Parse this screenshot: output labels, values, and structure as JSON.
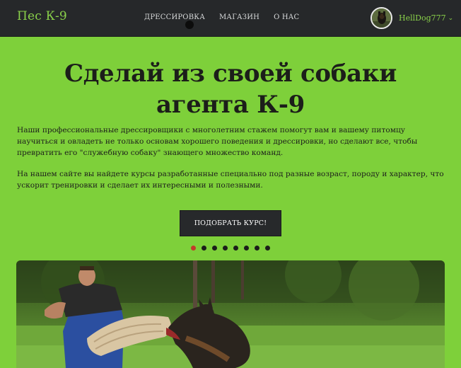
{
  "navbar": {
    "brand": "Пес К-9",
    "links": [
      {
        "label": "ДРЕССИРОВКА"
      },
      {
        "label": "МАГАЗИН"
      },
      {
        "label": "О НАС"
      }
    ],
    "user": {
      "name": "HellDog777"
    }
  },
  "hero": {
    "title": "Сделай из своей собаки агента К-9",
    "paragraph1": "Наши профессиональные дрессировщики с многолетним стажем помогут вам и вашему питомцу научиться и овладеть не только основам хорошего поведения и дрессировки, но сделают все, чтобы превратить его \"служебную собаку\" знающего множество команд.",
    "paragraph2": "На нашем сайте вы найдете курсы разработанные специально под разные возраст, породу и характер, что ускорит тренировки и сделает их интересными и полезными.",
    "cta_label": "ПОДОБРАТЬ КУРС!"
  },
  "carousel": {
    "active_index": 0,
    "slides": [
      {
        "image": "dog-training-photo"
      },
      {
        "image": "slide-2"
      },
      {
        "image": "slide-3"
      },
      {
        "image": "slide-4"
      },
      {
        "image": "slide-5"
      },
      {
        "image": "slide-6"
      },
      {
        "image": "slide-7"
      },
      {
        "image": "slide-8"
      }
    ]
  },
  "colors": {
    "page_bg": "#7ed03a",
    "navbar_bg": "#26282a",
    "brand": "#8ad14a",
    "cta_bg": "#27292b",
    "active_dot": "#c23a2a"
  }
}
